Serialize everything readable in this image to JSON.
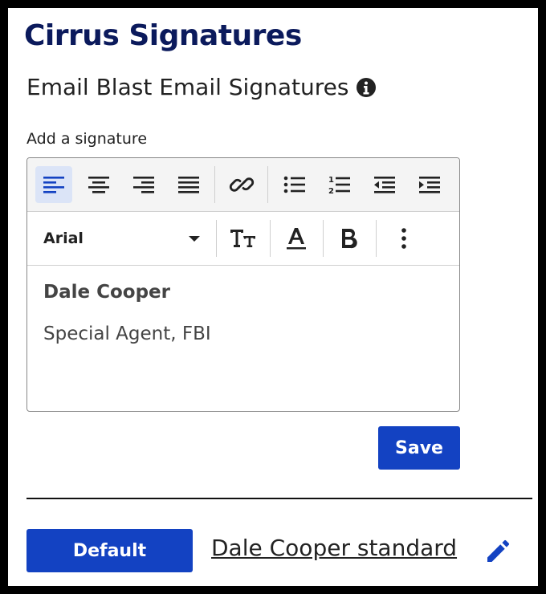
{
  "app": {
    "title": "Cirrus Signatures"
  },
  "section": {
    "title": "Email Blast Email Signatures",
    "info_icon": "info-circle-icon"
  },
  "form": {
    "label": "Add a signature"
  },
  "toolbar": {
    "row1": [
      {
        "name": "align-left-icon",
        "active": true
      },
      {
        "name": "align-center-icon",
        "active": false
      },
      {
        "name": "align-right-icon",
        "active": false
      },
      {
        "name": "align-justify-icon",
        "active": false
      },
      {
        "name": "link-icon",
        "active": false
      },
      {
        "name": "bulleted-list-icon",
        "active": false
      },
      {
        "name": "numbered-list-icon",
        "active": false
      },
      {
        "name": "outdent-icon",
        "active": false
      },
      {
        "name": "indent-icon",
        "active": false
      }
    ],
    "font_select": {
      "value": "Arial"
    },
    "row2": [
      "text-size-icon",
      "font-color-icon",
      "bold-icon",
      "more-vertical-icon"
    ]
  },
  "editor": {
    "name": "Dale Cooper",
    "title": "Special Agent, FBI"
  },
  "actions": {
    "save_label": "Save"
  },
  "signature_list": {
    "default_label": "Default",
    "signature_name": "Dale Cooper standard",
    "edit_icon": "pencil-icon"
  },
  "colors": {
    "brand_dark": "#0b1a5c",
    "primary": "#1342c2",
    "active_bg": "#dbe4f7"
  }
}
